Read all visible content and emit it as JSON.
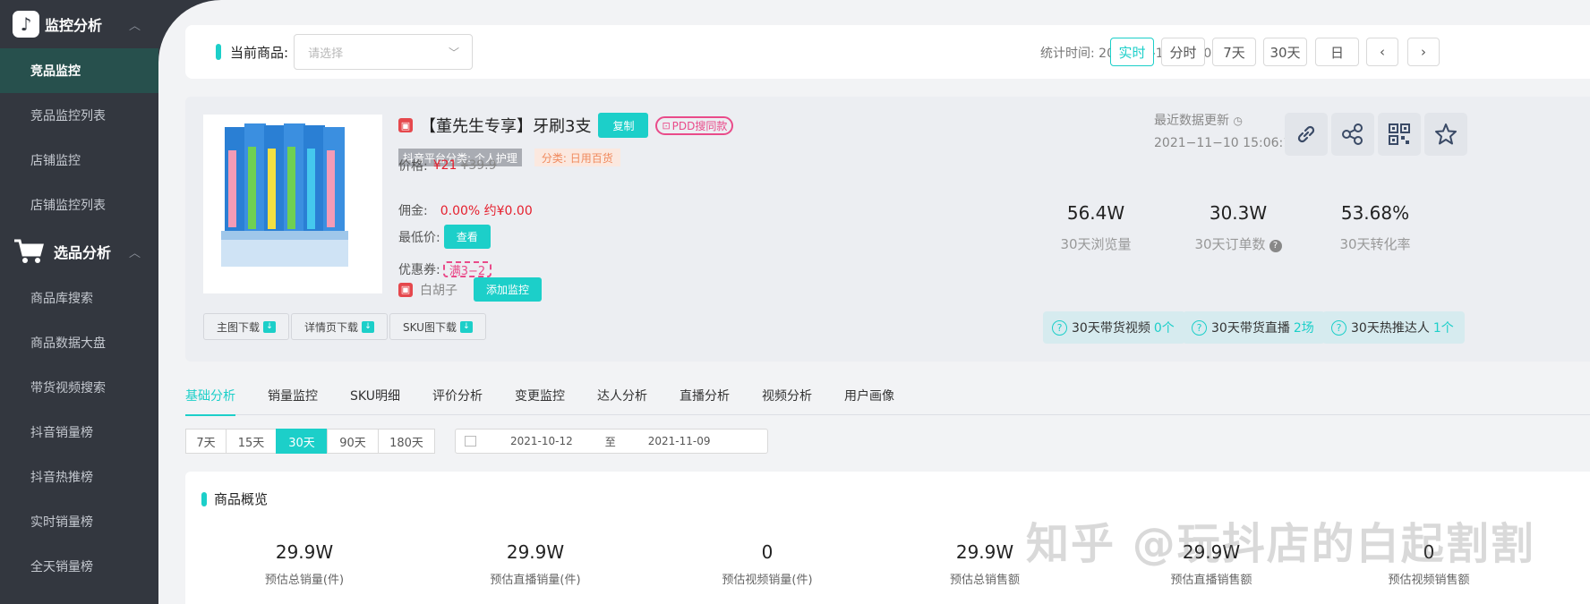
{
  "sidebar": {
    "groups": [
      {
        "label": "监控分析",
        "items": [
          "竞品监控",
          "竞品监控列表",
          "店铺监控",
          "店铺监控列表"
        ],
        "active": "竞品监控"
      },
      {
        "label": "选品分析",
        "items": [
          "商品库搜索",
          "商品数据大盘",
          "带货视频搜索",
          "抖音销量榜",
          "抖音热推榜",
          "实时销量榜",
          "全天销量榜"
        ]
      }
    ]
  },
  "topbar": {
    "current_label": "当前商品:",
    "select_placeholder": "请选择",
    "stat_time": "统计时间: 2021-10-16 13:00",
    "periods": [
      "实时",
      "分时",
      "7天",
      "30天",
      "日"
    ],
    "active_period": "实时"
  },
  "product": {
    "name": "【董先生专享】牙刷3支",
    "copy_label": "复制",
    "pdd_label": "PDD搜同款",
    "tag_platform": "抖音平台分类: 个人护理",
    "tag_category": "分类: 日用百货",
    "price_label": "价格:",
    "price": "¥21",
    "orig_price": "¥39.9",
    "commission_label": "佣金:",
    "commission": "0.00%  约¥0.00",
    "lowest_label": "最低价:",
    "view_label": "查看",
    "coupon_label": "优惠券:",
    "coupon": "满3−2",
    "shop": "白胡子",
    "add_monitor": "添加监控",
    "downloads": [
      "主图下载",
      "详情页下载",
      "SKU图下载"
    ],
    "update_label": "最近数据更新",
    "update_time": "2021−11−10 15:06:15"
  },
  "kpis": [
    {
      "value": "56.4W",
      "label": "30天浏览量"
    },
    {
      "value": "30.3W",
      "label": "30天订单数"
    },
    {
      "value": "53.68%",
      "label": "30天转化率"
    }
  ],
  "stat_badges": [
    {
      "label": "30天带货视频",
      "value": "0个"
    },
    {
      "label": "30天带货直播",
      "value": "2场"
    },
    {
      "label": "30天热推达人",
      "value": "1个"
    }
  ],
  "tabs": [
    "基础分析",
    "销量监控",
    "SKU明细",
    "评价分析",
    "变更监控",
    "达人分析",
    "直播分析",
    "视频分析",
    "用户画像"
  ],
  "active_tab": "基础分析",
  "ranges": [
    "7天",
    "15天",
    "30天",
    "90天",
    "180天"
  ],
  "active_range": "30天",
  "date_range": {
    "start": "2021-10-12",
    "sep": "至",
    "end": "2021-11-09"
  },
  "overview": {
    "title": "商品概览",
    "metrics": [
      {
        "value": "29.9W",
        "label": "预估总销量(件)"
      },
      {
        "value": "29.9W",
        "label": "预估直播销量(件)"
      },
      {
        "value": "0",
        "label": "预估视频销量(件)"
      },
      {
        "value": "29.9W",
        "label": "预估总销售额"
      },
      {
        "value": "29.9W",
        "label": "预估直播销售额"
      },
      {
        "value": "0",
        "label": "预估视频销售额"
      }
    ]
  },
  "watermark": "知乎 @玩抖店的白起割割",
  "colors": {
    "accent": "#1ccfc9",
    "sidebar_bg": "#33373f",
    "price_red": "#e5202e",
    "pdd_pink": "#e94b8a"
  }
}
